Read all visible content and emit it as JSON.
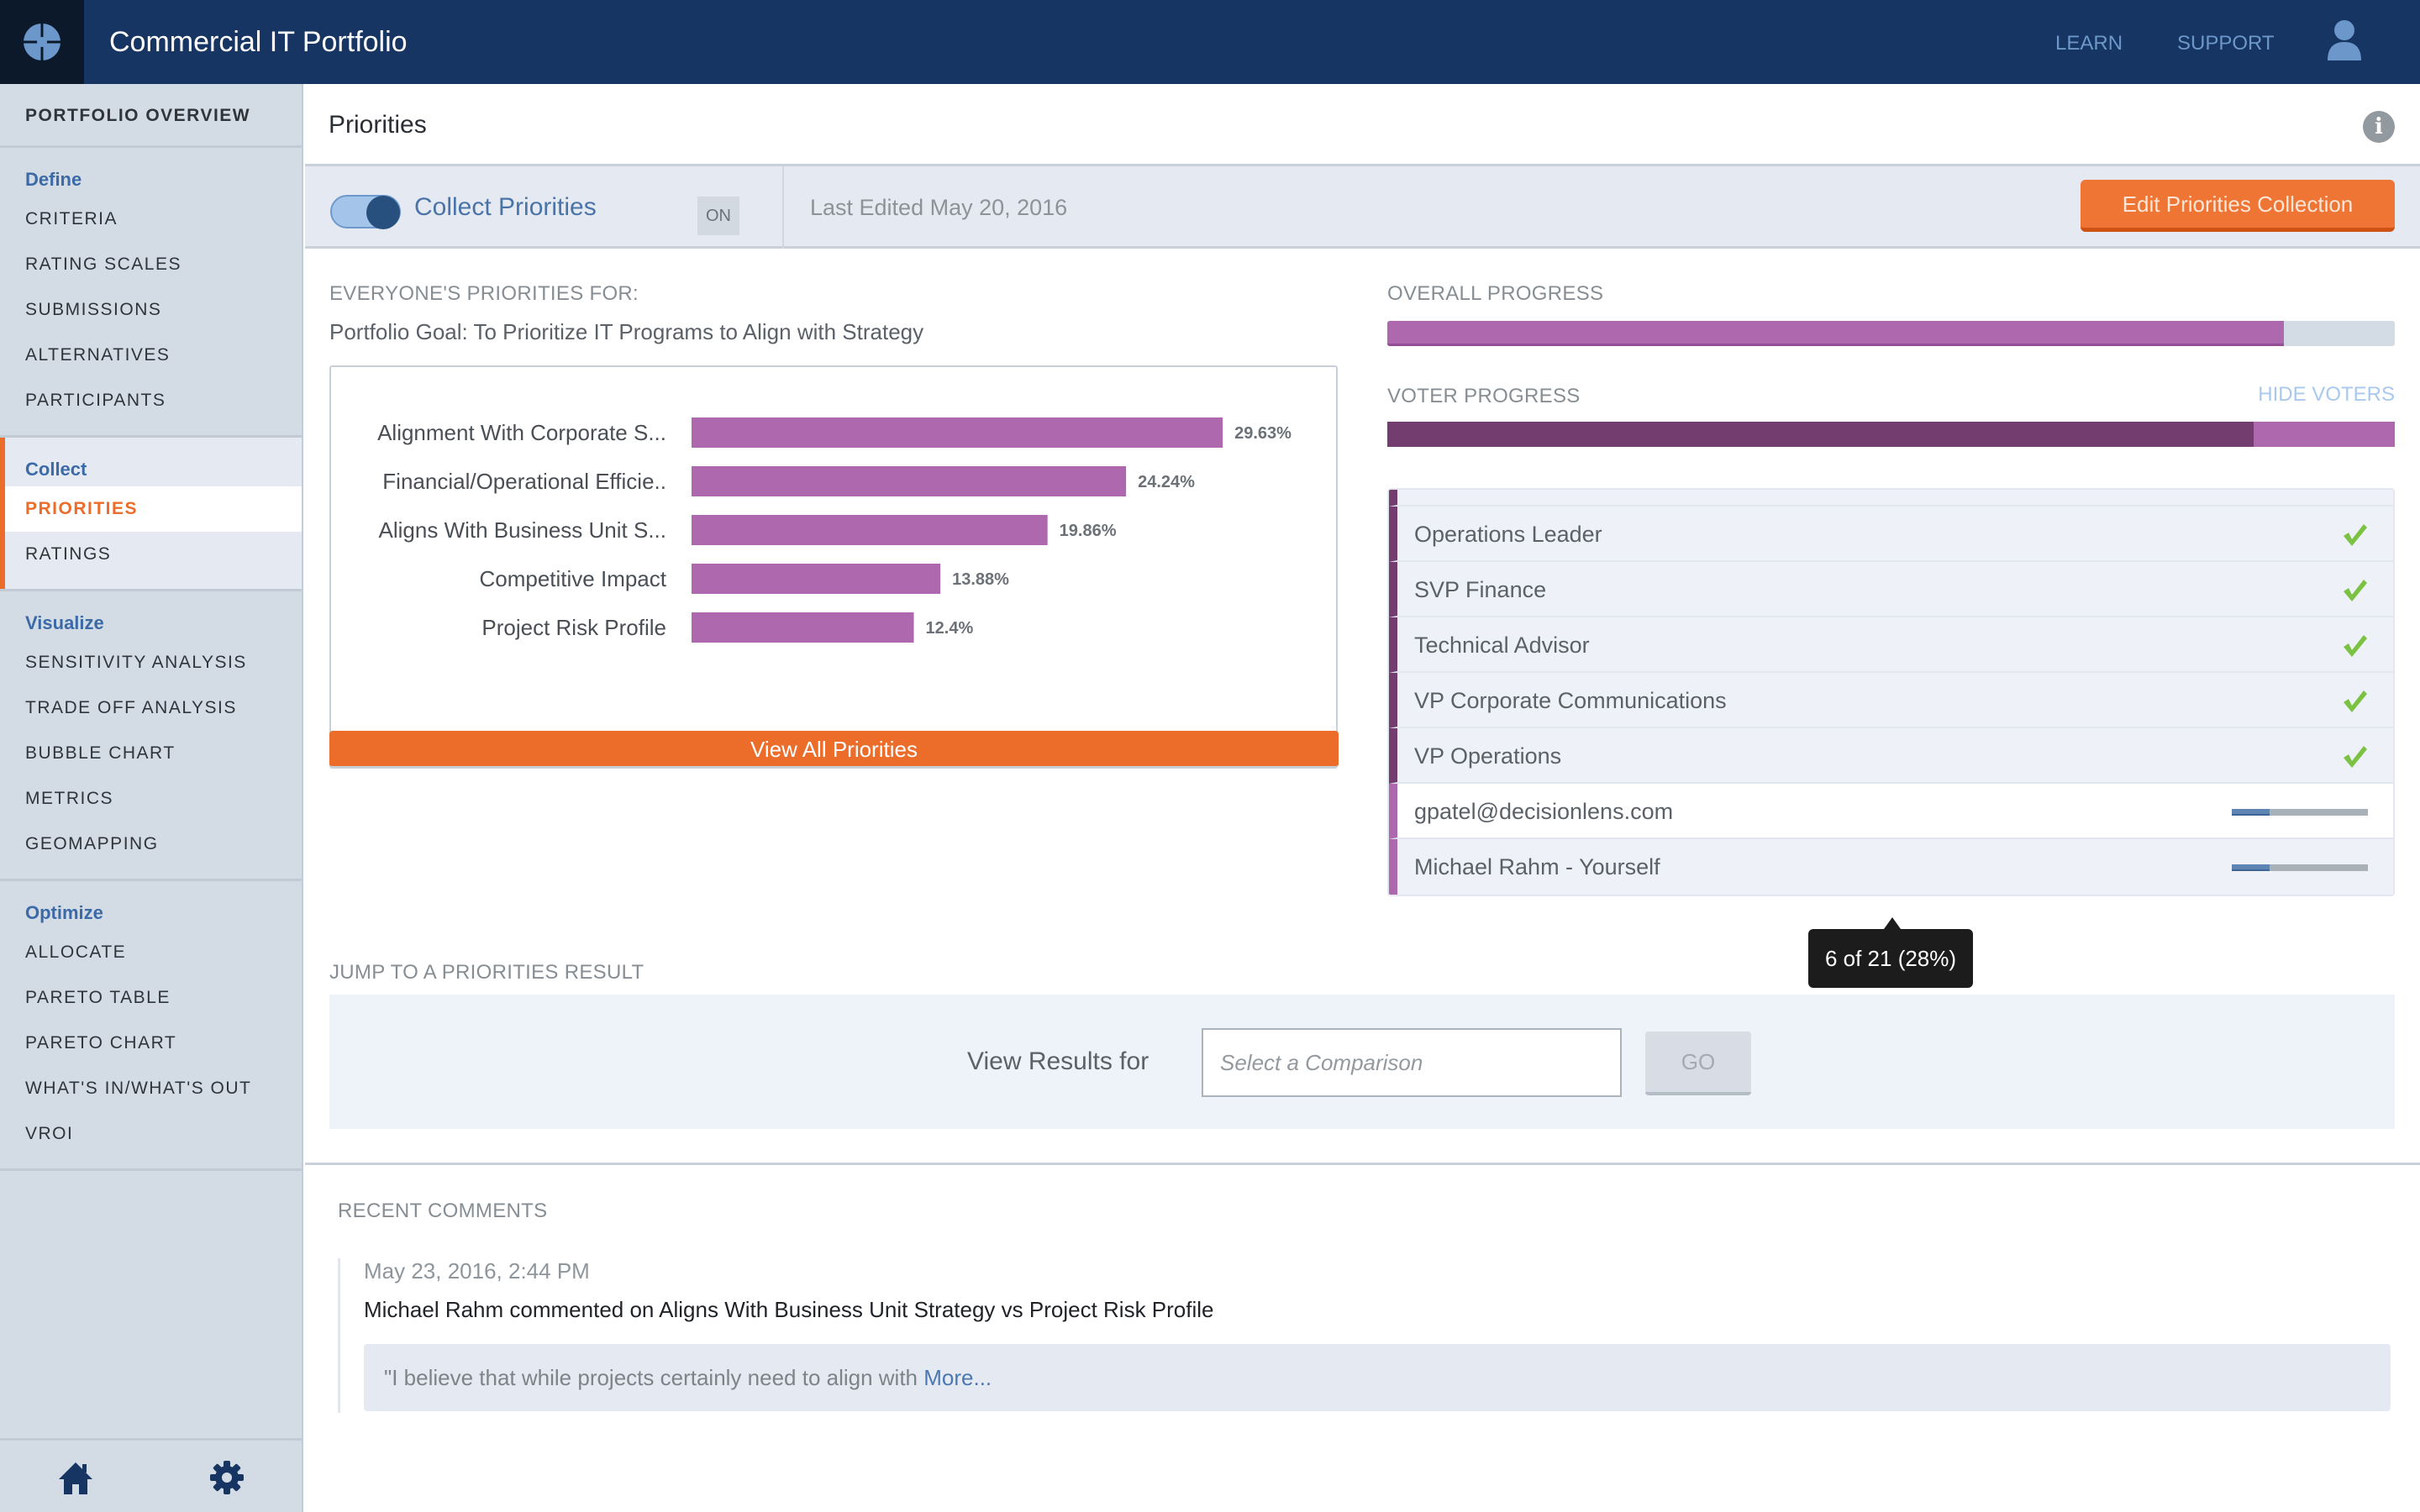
{
  "app": {
    "title": "Commercial IT Portfolio",
    "nav_links": [
      "LEARN",
      "SUPPORT"
    ],
    "icons": {
      "logo": "compass-logo-icon",
      "user": "user-icon",
      "info": "info-icon",
      "home": "home-icon",
      "settings": "gear-icon"
    }
  },
  "sidebar": {
    "overview": "PORTFOLIO OVERVIEW",
    "groups": [
      {
        "heading": "Define",
        "items": [
          "CRITERIA",
          "RATING SCALES",
          "SUBMISSIONS",
          "ALTERNATIVES",
          "PARTICIPANTS"
        ]
      },
      {
        "heading": "Collect",
        "items": [
          "PRIORITIES",
          "RATINGS"
        ],
        "active": true,
        "selected": "PRIORITIES"
      },
      {
        "heading": "Visualize",
        "items": [
          "SENSITIVITY ANALYSIS",
          "TRADE OFF ANALYSIS",
          "BUBBLE CHART",
          "METRICS",
          "GEOMAPPING"
        ]
      },
      {
        "heading": "Optimize",
        "items": [
          "ALLOCATE",
          "PARETO TABLE",
          "PARETO CHART",
          "WHAT'S IN/WHAT'S OUT",
          "VROI"
        ]
      }
    ]
  },
  "page": {
    "title": "Priorities"
  },
  "collect_bar": {
    "label": "Collect Priorities",
    "toggle_on": true,
    "state_badge": "ON",
    "last_edited": "Last Edited May 20, 2016",
    "edit_button": "Edit Priorities Collection"
  },
  "priorities": {
    "section_label": "EVERYONE'S PRIORITIES FOR:",
    "goal": "Portfolio Goal: To Prioritize IT Programs to Align with Strategy",
    "view_all_button": "View All Priorities"
  },
  "chart_data": {
    "type": "bar",
    "orientation": "horizontal",
    "title": "",
    "xlabel": "",
    "ylabel": "",
    "categories": [
      "Alignment With Corporate S...",
      "Financial/Operational Efficie..",
      "Aligns With Business Unit S...",
      "Competitive Impact",
      "Project Risk Profile"
    ],
    "values": [
      29.63,
      24.24,
      19.86,
      13.88,
      12.4
    ],
    "value_labels": [
      "29.63%",
      "24.24%",
      "19.86%",
      "13.88%",
      "12.4%"
    ],
    "xlim": [
      0,
      30
    ],
    "grid": false,
    "bar_color": "#ad68ae"
  },
  "progress": {
    "overall_label": "OVERALL PROGRESS",
    "overall_percent": 89,
    "voter_label": "VOTER PROGRESS",
    "voter_complete_percent": 86,
    "hide_voters": "HIDE VOTERS"
  },
  "voters": [
    {
      "name": "Operations Leader",
      "status": "complete"
    },
    {
      "name": "SVP Finance",
      "status": "complete"
    },
    {
      "name": "Technical Advisor",
      "status": "complete"
    },
    {
      "name": "VP Corporate Communications",
      "status": "complete"
    },
    {
      "name": "VP Operations",
      "status": "complete"
    },
    {
      "name": "gpatel@decisionlens.com",
      "status": "partial",
      "progress_percent": 28
    },
    {
      "name": "Michael Rahm - Yourself",
      "status": "partial",
      "progress_percent": 28
    }
  ],
  "tooltip": "6 of 21 (28%)",
  "jump": {
    "section_label": "JUMP TO A PRIORITIES RESULT",
    "view_results_label": "View Results for",
    "comparison_placeholder": "Select a Comparison",
    "comparison_value": "",
    "go_button": "GO"
  },
  "comments": {
    "section_label": "RECENT COMMENTS",
    "items": [
      {
        "date": "May 23, 2016, 2:44 PM",
        "text": "Michael Rahm commented on Aligns With Business Unit Strategy vs Project Risk Profile",
        "quote": "\"I believe that while projects certainly need to align with ",
        "more_link": "More..."
      }
    ]
  },
  "colors": {
    "nav_bg": "#163562",
    "accent_orange": "#ec6c2a",
    "accent_blue": "#3c6aa6",
    "purple": "#ad68ae",
    "dark_purple": "#733d6f",
    "check_green": "#7cc242"
  }
}
